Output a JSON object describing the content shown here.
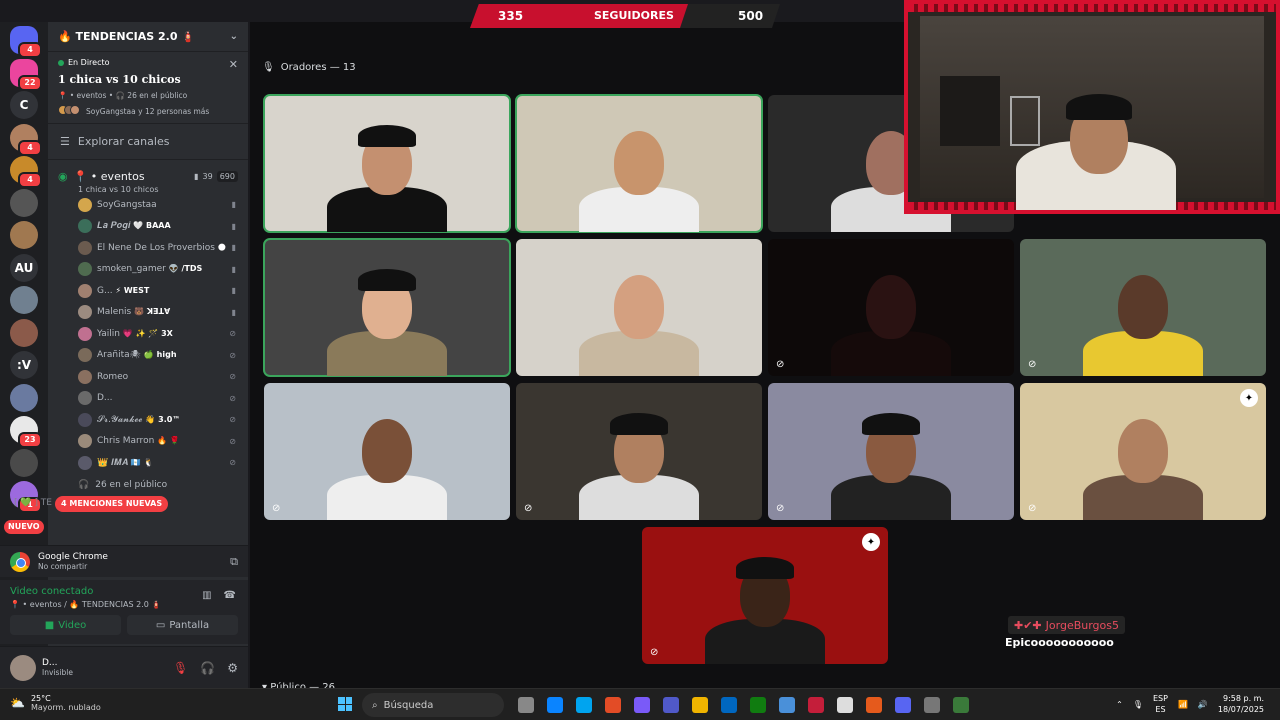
{
  "server": {
    "name": "🔥 TENDENCIAS 2.0 🧯"
  },
  "rail": [
    {
      "label": "",
      "badge": "4",
      "color": "#5865f2"
    },
    {
      "label": "",
      "badge": "22",
      "color": "#eb459e"
    },
    {
      "label": "C",
      "badge": "",
      "color": "#313338"
    },
    {
      "label": "",
      "badge": "4",
      "color": "#b08060"
    },
    {
      "label": "",
      "badge": "4",
      "color": "#c88a2a"
    },
    {
      "label": "",
      "badge": "",
      "color": "#555"
    },
    {
      "label": "",
      "badge": "",
      "color": "#a07850"
    },
    {
      "label": "AU",
      "badge": "",
      "color": "#313338"
    },
    {
      "label": "",
      "badge": "",
      "color": "#708090"
    },
    {
      "label": "",
      "badge": "",
      "color": "#8b5a4a"
    },
    {
      "label": ":V",
      "badge": "",
      "color": "#313338"
    },
    {
      "label": "",
      "badge": "",
      "color": "#6a7aa0"
    },
    {
      "label": "",
      "badge": "23",
      "color": "#e8e8e8"
    },
    {
      "label": "",
      "badge": "",
      "color": "#4a4a4a"
    },
    {
      "label": "",
      "badge": "1",
      "color": "#9c6ade"
    }
  ],
  "rail_new": "NUEVO",
  "live": {
    "tag": "En Directo",
    "title": "1 chica vs 10 chicos",
    "meta": "📍 • eventos • 🎧 26 en el público",
    "people": "SoyGangstaa y 12 personas más"
  },
  "explore": "Explorar canales",
  "voice_channel": {
    "name": "📍 • eventos",
    "video_count": "39",
    "listeners": "690",
    "status": "1 chica vs 10 chicos"
  },
  "members": [
    {
      "name": "SoyGangstaa",
      "tag": "",
      "color": "#d4a64c"
    },
    {
      "name": "𝑳𝒂 𝑷𝒐𝒈𝒊",
      "tag": "🤍 BAAA",
      "color": "#3b6e5a"
    },
    {
      "name": "El Nene De Los Proverbios",
      "tag": "🌑",
      "color": "#6b5b4f"
    },
    {
      "name": "smoken_gamer",
      "tag": "👽 /TDS",
      "color": "#4f6b4f"
    },
    {
      "name": "G...",
      "tag": "⚡ WEST",
      "color": "#a08070"
    },
    {
      "name": "Malenis",
      "tag": "🐻 ꓘꓱꓕꓯ",
      "color": "#9b8b80"
    },
    {
      "name": "Yailin",
      "tag": "💗 ✨ 🪄 3X",
      "color": "#c07090"
    },
    {
      "name": "Arañita🕷",
      "tag": "🍏 high",
      "color": "#7a6a5a"
    },
    {
      "name": "Romeo",
      "tag": "",
      "color": "#8a7060"
    },
    {
      "name": "D...",
      "tag": "",
      "color": "#6a6a6a"
    },
    {
      "name": "𝓢𝓻.𝓨𝓪𝓷𝓴𝓮𝓮",
      "tag": "👋 3.0™",
      "color": "#4a4a5a"
    },
    {
      "name": "Chris Marron",
      "tag": "🔥 🌹",
      "color": "#9a8a7a"
    },
    {
      "name": "👑 𝑰𝑴𝑨",
      "tag": "🇬🇹 🐧",
      "color": "#5a5a6a"
    }
  ],
  "audience": "26 en el público",
  "mentions": "4 MENCIONES NUEVAS",
  "next_channel": "[ 💚 ] TE",
  "chrome": {
    "title": "Google Chrome",
    "sub": "No compartir"
  },
  "voice_conn": {
    "title": "Video conectado",
    "sub": "📍 • eventos / 🔥 TENDENCIAS 2.0 🧯",
    "video": "Video",
    "screen": "Pantalla"
  },
  "user": {
    "name": "D...",
    "status": "Invisible"
  },
  "stage": {
    "speakers": "Oradores — 13",
    "public": "Público — 26"
  },
  "tiles": [
    {
      "bg": "#d8d4cc",
      "face": "#c49070",
      "shirt": "#111",
      "cap": true,
      "active": true,
      "muted": false,
      "shield": false
    },
    {
      "bg": "#cfc8b6",
      "face": "#c8946c",
      "shirt": "#eee",
      "cap": false,
      "active": true,
      "muted": false,
      "shield": false
    },
    {
      "bg": "#2a2a2a",
      "face": "#a07060",
      "shirt": "#ddd",
      "cap": false,
      "active": false,
      "muted": false,
      "shield": false
    },
    {
      "bg": "#444",
      "face": "#e0b090",
      "shirt": "#8a7a5a",
      "cap": true,
      "active": true,
      "muted": false,
      "shield": false
    },
    {
      "bg": "#d6d2ca",
      "face": "#d4a080",
      "shirt": "#c8b8a0",
      "cap": false,
      "active": false,
      "muted": false,
      "shield": false
    },
    {
      "bg": "#0d0909",
      "face": "#2a1212",
      "shirt": "#150a0a",
      "cap": false,
      "active": false,
      "muted": true,
      "shield": false
    },
    {
      "bg": "#5a6a5a",
      "face": "#5a3a2a",
      "shirt": "#e8c830",
      "cap": false,
      "active": false,
      "muted": true,
      "shield": false
    },
    {
      "bg": "#b8c0c8",
      "face": "#7a5038",
      "shirt": "#eee",
      "cap": false,
      "active": false,
      "muted": true,
      "shield": false
    },
    {
      "bg": "#3a3630",
      "face": "#b08060",
      "shirt": "#ddd",
      "cap": true,
      "active": false,
      "muted": true,
      "shield": false
    },
    {
      "bg": "#8a8aa0",
      "face": "#8a5a40",
      "shirt": "#222",
      "cap": true,
      "active": false,
      "muted": true,
      "shield": false
    },
    {
      "bg": "#d8c8a0",
      "face": "#b08060",
      "shirt": "#6a5040",
      "cap": false,
      "active": false,
      "muted": true,
      "shield": true
    },
    {
      "bg": "#9a1010",
      "face": "#3a2418",
      "shirt": "#1a1a1a",
      "cap": true,
      "active": false,
      "muted": true,
      "shield": true
    }
  ],
  "overlay": {
    "left_num": "335",
    "label": "SEGUIDORES",
    "right_num": "500"
  },
  "chat": {
    "name": "JorgeBurgos5",
    "message": "Epicooooooooooo"
  },
  "taskbar": {
    "temp": "25°C",
    "weather": "Mayorm. nublado",
    "search": "Búsqueda",
    "lang1": "ESP",
    "lang2": "ES",
    "time": "9:58 p. m.",
    "date": "18/07/2025"
  }
}
